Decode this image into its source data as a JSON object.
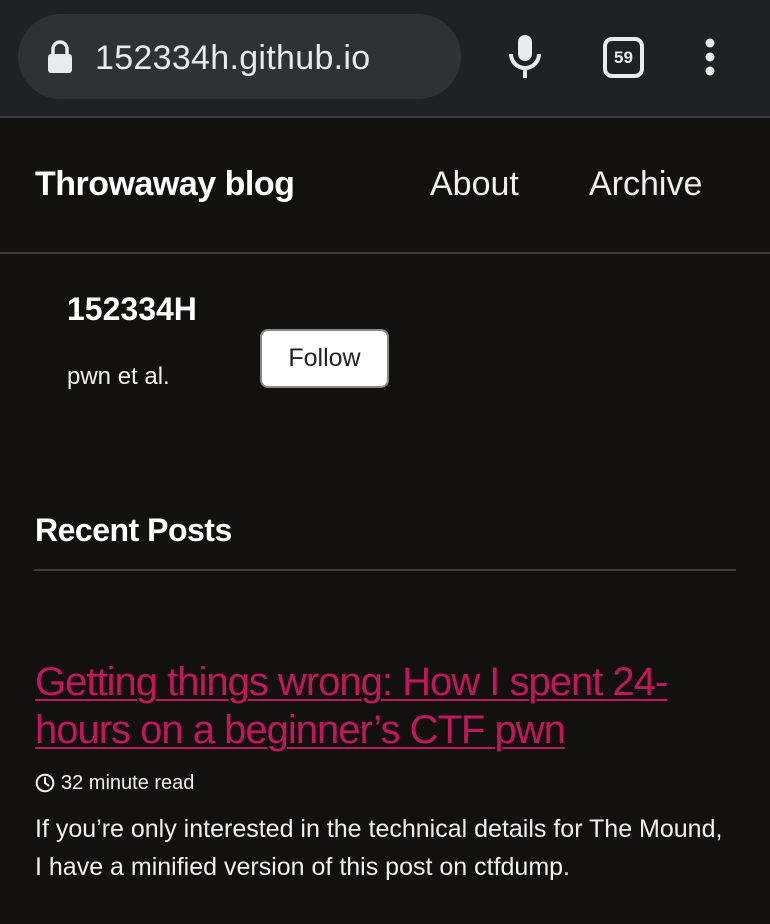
{
  "browser": {
    "url": "152334h.github.io",
    "tab_count": "59"
  },
  "site": {
    "title": "Throwaway blog",
    "nav": [
      {
        "label": "About"
      },
      {
        "label": "Archive"
      }
    ]
  },
  "author": {
    "name": "152334H",
    "bio": "pwn et al.",
    "follow_label": "Follow"
  },
  "recent": {
    "heading": "Recent Posts",
    "posts": [
      {
        "title": "Getting things wrong: How I spent 24-hours on a beginner’s CTF pwn",
        "read_time": "32 minute read",
        "excerpt": "If you’re only interested in the technical details for The Mound, I have a minified version of this post on ctfdump."
      }
    ]
  },
  "colors": {
    "background": "#131010",
    "toolbar": "#202124",
    "link": "#c2185b"
  },
  "icons": {
    "lock": "lock-icon",
    "mic": "microphone-icon",
    "tabs": "tab-switcher-icon",
    "menu": "more-vert-icon",
    "clock": "clock-icon"
  }
}
